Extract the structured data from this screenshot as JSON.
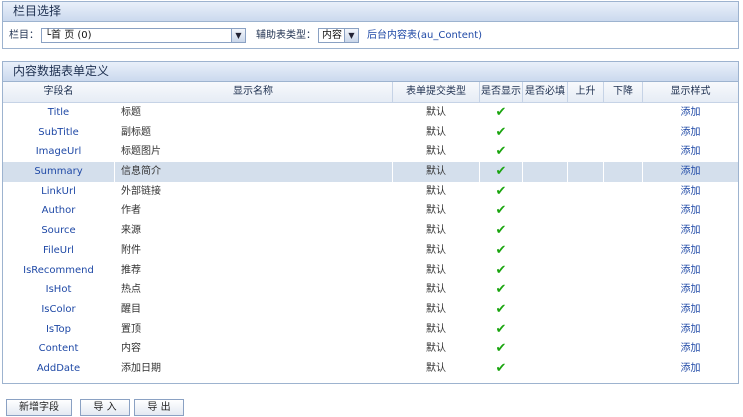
{
  "section1": {
    "title": "栏目选择",
    "column_label": "栏目：",
    "column_value": "└首 页 (0)",
    "aux_label": "辅助表类型：",
    "aux_value": "内容",
    "backend_table": "后台内容表(au_Content)"
  },
  "section2": {
    "title": "内容数据表单定义",
    "headers": [
      "字段名",
      "显示名称",
      "表单提交类型",
      "是否显示",
      "是否必填",
      "上升",
      "下降",
      "显示样式"
    ],
    "rows": [
      {
        "field": "Title",
        "name": "标题",
        "type": "默认",
        "style": "添加"
      },
      {
        "field": "SubTitle",
        "name": "副标题",
        "type": "默认",
        "style": "添加"
      },
      {
        "field": "ImageUrl",
        "name": "标题图片",
        "type": "默认",
        "style": "添加"
      },
      {
        "field": "Summary",
        "name": "信息简介",
        "type": "默认",
        "style": "添加"
      },
      {
        "field": "LinkUrl",
        "name": "外部链接",
        "type": "默认",
        "style": "添加"
      },
      {
        "field": "Author",
        "name": "作者",
        "type": "默认",
        "style": "添加"
      },
      {
        "field": "Source",
        "name": "来源",
        "type": "默认",
        "style": "添加"
      },
      {
        "field": "FileUrl",
        "name": "附件",
        "type": "默认",
        "style": "添加"
      },
      {
        "field": "IsRecommend",
        "name": "推荐",
        "type": "默认",
        "style": "添加"
      },
      {
        "field": "IsHot",
        "name": "热点",
        "type": "默认",
        "style": "添加"
      },
      {
        "field": "IsColor",
        "name": "醒目",
        "type": "默认",
        "style": "添加"
      },
      {
        "field": "IsTop",
        "name": "置顶",
        "type": "默认",
        "style": "添加"
      },
      {
        "field": "Content",
        "name": "内容",
        "type": "默认",
        "style": "添加"
      },
      {
        "field": "AddDate",
        "name": "添加日期",
        "type": "默认",
        "style": "添加"
      }
    ],
    "selected_row": 3
  },
  "buttons": {
    "add_field": "新增字段",
    "import": "导 入",
    "export": "导 出"
  },
  "icons": {
    "check": "check-icon",
    "dropdown": "chevron-down-icon"
  },
  "colors": {
    "accent": "#1f49a6",
    "check": "#1aa50f",
    "selected_row": "#d4dfec"
  }
}
